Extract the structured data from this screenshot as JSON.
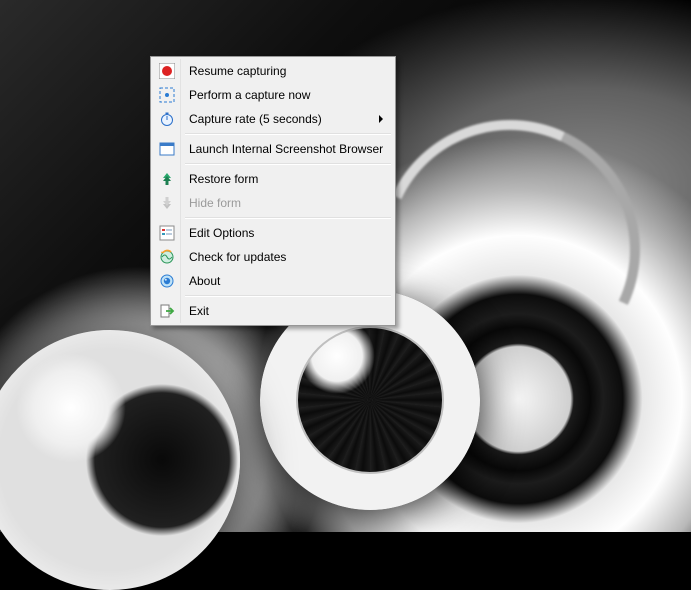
{
  "menu": {
    "items": [
      {
        "label": "Resume capturing"
      },
      {
        "label": "Perform a capture now"
      },
      {
        "label": "Capture rate (5 seconds)"
      },
      {
        "label": "Launch Internal Screenshot Browser"
      },
      {
        "label": "Restore form"
      },
      {
        "label": "Hide form"
      },
      {
        "label": "Edit Options"
      },
      {
        "label": "Check for updates"
      },
      {
        "label": "About"
      },
      {
        "label": "Exit"
      }
    ]
  }
}
